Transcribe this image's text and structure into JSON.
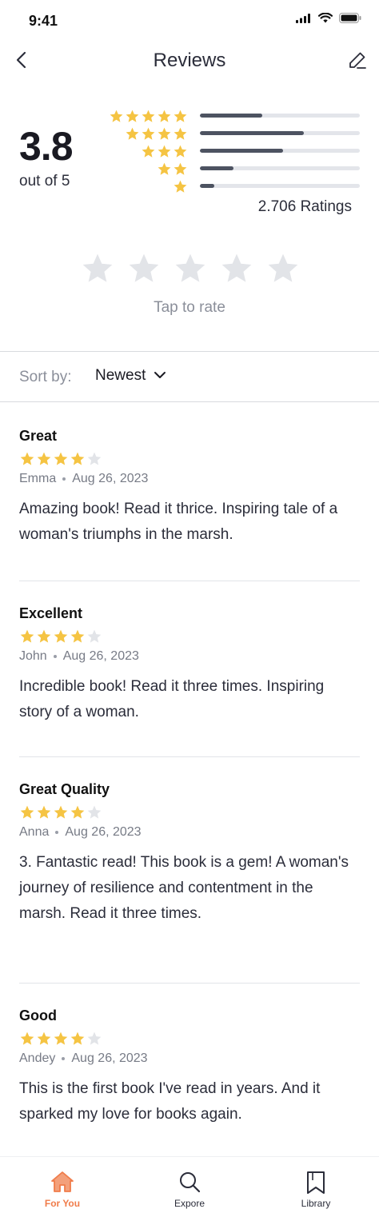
{
  "status_bar": {
    "time": "9:41"
  },
  "nav": {
    "title": "Reviews"
  },
  "summary": {
    "average": "3.8",
    "caption": "out of 5",
    "ratings_count": "2.706 Ratings",
    "distribution": [
      {
        "stars": 5,
        "fraction": 0.39
      },
      {
        "stars": 4,
        "fraction": 0.65
      },
      {
        "stars": 3,
        "fraction": 0.52
      },
      {
        "stars": 2,
        "fraction": 0.21
      },
      {
        "stars": 1,
        "fraction": 0.09
      }
    ]
  },
  "tap_to_rate": {
    "caption": "Tap to rate",
    "max_stars": 5
  },
  "sort": {
    "label": "Sort by:",
    "value": "Newest"
  },
  "reviews": [
    {
      "title": "Great",
      "rating": 4,
      "author": "Emma",
      "date": "Aug 26, 2023",
      "body": "Amazing book! Read it thrice. Inspiring tale of a woman's triumphs in the marsh."
    },
    {
      "title": "Excellent",
      "rating": 4,
      "author": "John",
      "date": "Aug 26, 2023",
      "body": "Incredible book! Read it three times. Inspiring story of a woman."
    },
    {
      "title": "Great Quality",
      "rating": 4,
      "author": "Anna",
      "date": "Aug 26, 2023",
      "body": "3. Fantastic read! This book is a gem! A woman's journey of resilience and contentment in the marsh. Read it three times."
    },
    {
      "title": "Good",
      "rating": 4,
      "author": "Andey",
      "date": "Aug 26, 2023",
      "body": "This is the first book I've read in years. And it sparked my love for books again."
    }
  ],
  "tabs": [
    {
      "label": "For You",
      "icon": "home-icon",
      "active": true
    },
    {
      "label": "Expore",
      "icon": "search-icon",
      "active": false
    },
    {
      "label": "Library",
      "icon": "bookmark-icon",
      "active": false
    }
  ],
  "colors": {
    "star_filled": "#F5C443",
    "star_empty": "#E2E4E8",
    "accent": "#F07C4A",
    "bar_fill": "#4D5361",
    "bar_track": "#E3E5EA"
  }
}
